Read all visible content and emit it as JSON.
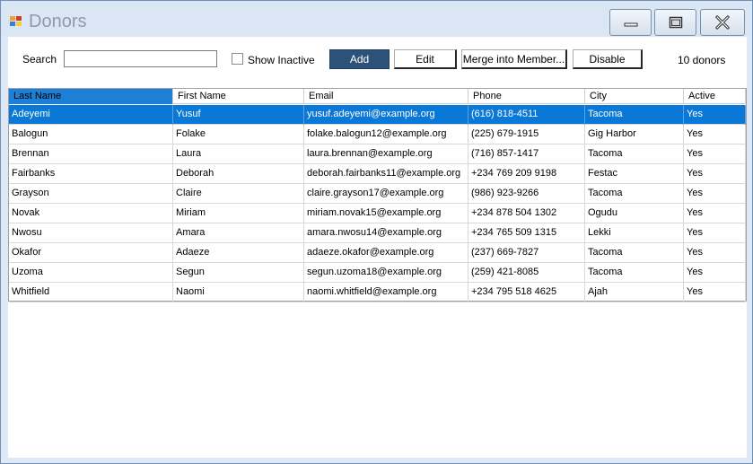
{
  "window": {
    "title": "Donors"
  },
  "toolbar": {
    "search_label": "Search",
    "search_value": "",
    "show_inactive_label": "Show Inactive",
    "add_label": "Add",
    "edit_label": "Edit",
    "merge_label": "Merge into Member...",
    "disable_label": "Disable",
    "count_label": "10 donors"
  },
  "grid": {
    "columns": [
      "Last Name",
      "First Name",
      "Email",
      "Phone",
      "City",
      "Active"
    ],
    "rows": [
      [
        "Adeyemi",
        "Yusuf",
        "yusuf.adeyemi@example.org",
        "(616) 818-4511",
        "Tacoma",
        "Yes"
      ],
      [
        "Balogun",
        "Folake",
        "folake.balogun12@example.org",
        "(225) 679-1915",
        "Gig Harbor",
        "Yes"
      ],
      [
        "Brennan",
        "Laura",
        "laura.brennan@example.org",
        "(716) 857-1417",
        "Tacoma",
        "Yes"
      ],
      [
        "Fairbanks",
        "Deborah",
        "deborah.fairbanks11@example.org",
        "+234 769 209 9198",
        "Festac",
        "Yes"
      ],
      [
        "Grayson",
        "Claire",
        "claire.grayson17@example.org",
        "(986) 923-9266",
        "Tacoma",
        "Yes"
      ],
      [
        "Novak",
        "Miriam",
        "miriam.novak15@example.org",
        "+234 878 504 1302",
        "Ogudu",
        "Yes"
      ],
      [
        "Nwosu",
        "Amara",
        "amara.nwosu14@example.org",
        "+234 765 509 1315",
        "Lekki",
        "Yes"
      ],
      [
        "Okafor",
        "Adaeze",
        "adaeze.okafor@example.org",
        "(237) 669-7827",
        "Tacoma",
        "Yes"
      ],
      [
        "Uzoma",
        "Segun",
        "segun.uzoma18@example.org",
        "(259) 421-8085",
        "Tacoma",
        "Yes"
      ],
      [
        "Whitfield",
        "Naomi",
        "naomi.whitfield@example.org",
        "+234 795 518 4625",
        "Ajah",
        "Yes"
      ]
    ],
    "selected_row": 0
  },
  "colors": {
    "selection": "#0a78d7",
    "add_button": "#2c5279",
    "titlebar": "#dbe6f4"
  },
  "icons": {
    "app": "app-icon",
    "minimize": "minimize-icon",
    "maximize": "maximize-icon",
    "close": "close-icon",
    "checkbox": "checkbox-icon"
  }
}
